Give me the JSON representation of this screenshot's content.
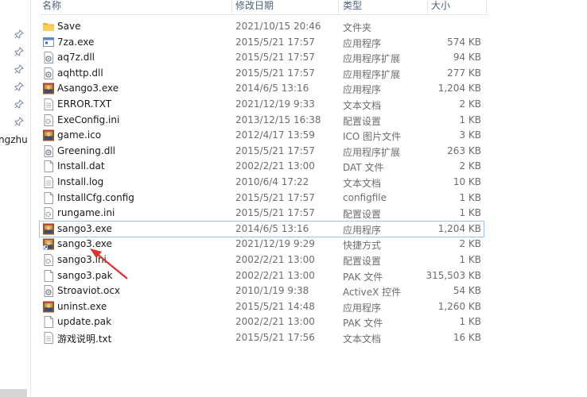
{
  "nav": {
    "partial_label": "ngzhu",
    "pin_icons": [
      "pin-icon",
      "pin-icon",
      "pin-icon",
      "pin-icon",
      "pin-icon",
      "pin-icon"
    ]
  },
  "columns": {
    "name": "名称",
    "date": "修改日期",
    "type": "类型",
    "size": "大小"
  },
  "files": [
    {
      "name": "Save",
      "date": "2021/10/15 20:46",
      "type": "文件夹",
      "size": "",
      "icon": "folder-icon"
    },
    {
      "name": "7za.exe",
      "date": "2015/5/21 17:57",
      "type": "应用程序",
      "size": "574 KB",
      "icon": "exe-icon"
    },
    {
      "name": "aq7z.dll",
      "date": "2015/5/21 17:57",
      "type": "应用程序扩展",
      "size": "94 KB",
      "icon": "dll-icon"
    },
    {
      "name": "aqhttp.dll",
      "date": "2015/5/21 17:57",
      "type": "应用程序扩展",
      "size": "277 KB",
      "icon": "dll-icon"
    },
    {
      "name": "Asango3.exe",
      "date": "2014/6/5 13:16",
      "type": "应用程序",
      "size": "1,204 KB",
      "icon": "game-icon"
    },
    {
      "name": "ERROR.TXT",
      "date": "2021/12/19 9:33",
      "type": "文本文档",
      "size": "2 KB",
      "icon": "text-file-icon"
    },
    {
      "name": "ExeConfig.ini",
      "date": "2013/12/15 16:38",
      "type": "配置设置",
      "size": "1 KB",
      "icon": "settings-file-icon"
    },
    {
      "name": "game.ico",
      "date": "2012/4/17 13:59",
      "type": "ICO 图片文件",
      "size": "3 KB",
      "icon": "game-icon"
    },
    {
      "name": "Greening.dll",
      "date": "2015/5/21 17:57",
      "type": "应用程序扩展",
      "size": "263 KB",
      "icon": "dll-icon"
    },
    {
      "name": "Install.dat",
      "date": "2002/2/21 13:00",
      "type": "DAT 文件",
      "size": "2 KB",
      "icon": "blank-file-icon"
    },
    {
      "name": "Install.log",
      "date": "2010/6/4 17:22",
      "type": "文本文档",
      "size": "10 KB",
      "icon": "text-file-icon"
    },
    {
      "name": "InstallCfg.config",
      "date": "2015/5/21 17:57",
      "type": "configfile",
      "size": "1 KB",
      "icon": "blank-file-icon"
    },
    {
      "name": "rungame.ini",
      "date": "2015/5/21 17:57",
      "type": "配置设置",
      "size": "1 KB",
      "icon": "settings-file-icon"
    },
    {
      "name": "sango3.exe",
      "date": "2014/6/5 13:16",
      "type": "应用程序",
      "size": "1,204 KB",
      "icon": "game-icon",
      "selected": true
    },
    {
      "name": "sango3.exe",
      "date": "2021/12/19 9:29",
      "type": "快捷方式",
      "size": "2 KB",
      "icon": "game-shortcut-icon"
    },
    {
      "name": "sango3.ini",
      "date": "2002/2/21 13:00",
      "type": "配置设置",
      "size": "1 KB",
      "icon": "settings-file-icon"
    },
    {
      "name": "sango3.pak",
      "date": "2002/2/21 13:00",
      "type": "PAK 文件",
      "size": "315,503 KB",
      "icon": "blank-file-icon"
    },
    {
      "name": "Stroaviot.ocx",
      "date": "2010/1/19 9:38",
      "type": "ActiveX 控件",
      "size": "54 KB",
      "icon": "dll-icon"
    },
    {
      "name": "uninst.exe",
      "date": "2015/5/21 14:48",
      "type": "应用程序",
      "size": "1,260 KB",
      "icon": "game-icon"
    },
    {
      "name": "update.pak",
      "date": "2002/2/21 13:00",
      "type": "PAK 文件",
      "size": "1 KB",
      "icon": "blank-file-icon"
    },
    {
      "name": "游戏说明.txt",
      "date": "2015/5/21 17:56",
      "type": "文本文档",
      "size": "16 KB",
      "icon": "text-file-icon"
    }
  ],
  "colors": {
    "header_text": "#4c607a",
    "selection_border": "#9ec6ea",
    "arrow": "#e0312b",
    "folder": "#f5c242"
  }
}
